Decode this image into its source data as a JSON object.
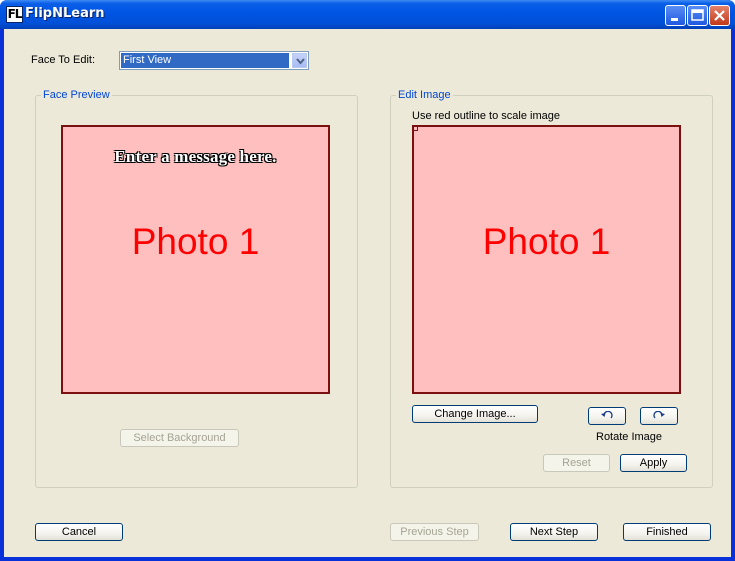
{
  "window": {
    "title": "FlipNLearn",
    "app_icon_text": "FL",
    "title_buttons": [
      "minimize-icon",
      "maximize-icon",
      "close-icon"
    ]
  },
  "face_selector": {
    "label": "Face To Edit:",
    "selected": "First View"
  },
  "preview": {
    "group_title": "Face Preview",
    "message": "Enter a message here.",
    "photo_label": "Photo 1",
    "select_background_label": "Select Background"
  },
  "edit": {
    "group_title": "Edit Image",
    "hint": "Use red outline to scale image",
    "photo_label": "Photo 1",
    "change_image_label": "Change Image...",
    "rotate_label": "Rotate Image",
    "rotate_left_icon": "rotate-left-icon",
    "rotate_right_icon": "rotate-right-icon",
    "reset_label": "Reset",
    "apply_label": "Apply"
  },
  "footer": {
    "cancel_label": "Cancel",
    "previous_label": "Previous Step",
    "next_label": "Next Step",
    "finished_label": "Finished"
  },
  "colors": {
    "photo_fill": "#ffbfbf",
    "photo_text": "#ff0000",
    "group_title": "#0046d5",
    "titlebar": "#0054e3"
  }
}
